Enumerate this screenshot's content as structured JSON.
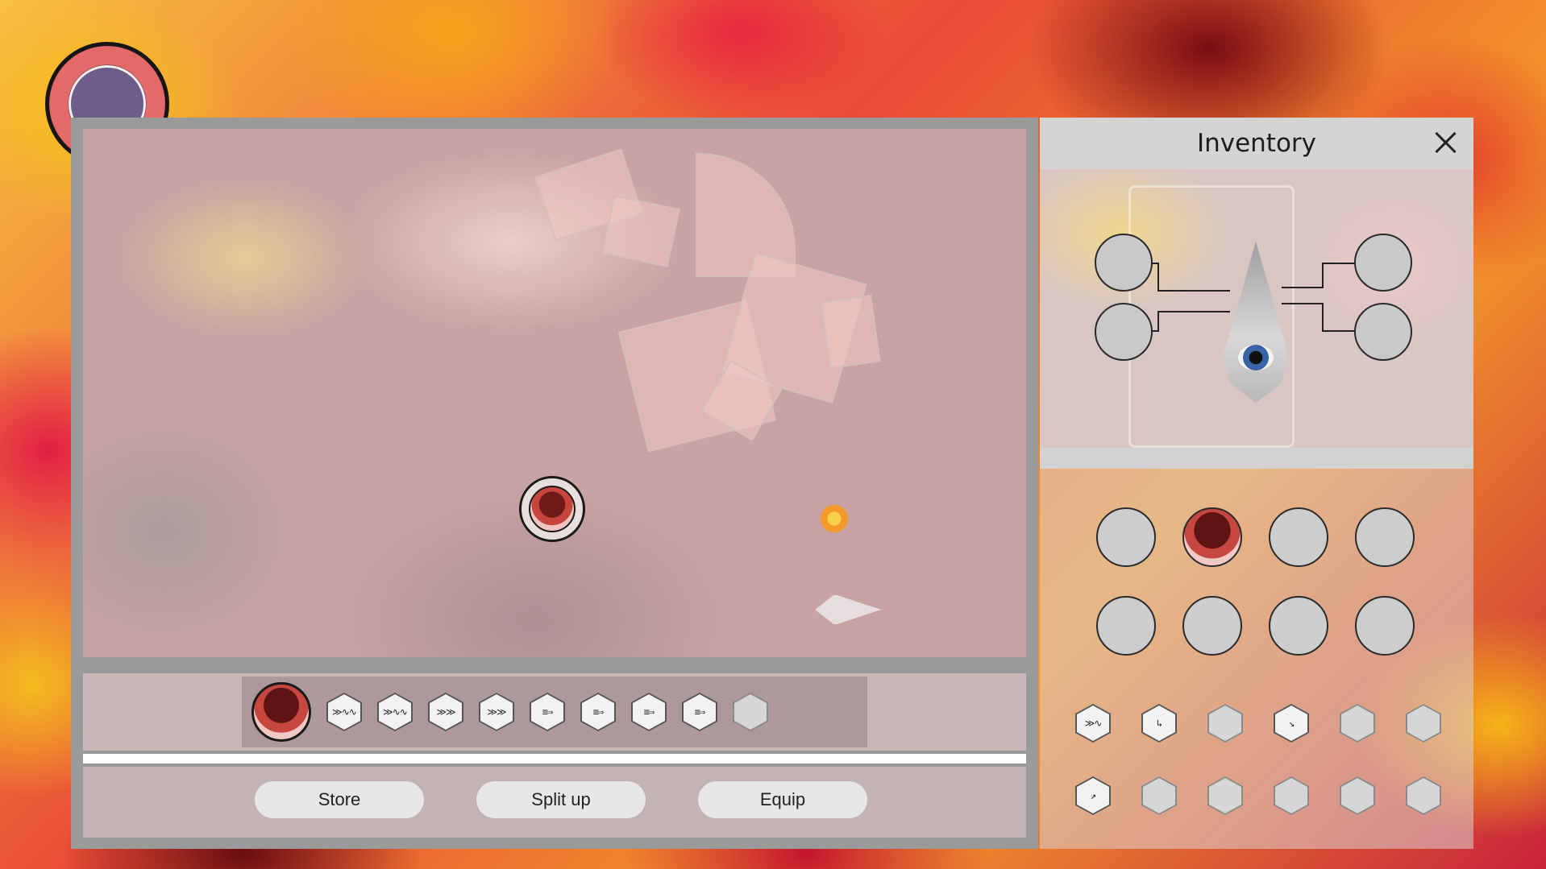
{
  "inventory": {
    "title": "Inventory",
    "close_icon": "close-icon"
  },
  "actions": {
    "store_label": "Store",
    "split_label": "Split up",
    "equip_label": "Equip"
  },
  "hotbar": {
    "slots": [
      {
        "kind": "orb",
        "icon": "core-orb-icon"
      },
      {
        "kind": "hex",
        "glyph": "≫∿∿"
      },
      {
        "kind": "hex",
        "glyph": "≫∿∿"
      },
      {
        "kind": "hex",
        "glyph": "≫≫"
      },
      {
        "kind": "hex",
        "glyph": "≫≫"
      },
      {
        "kind": "hex",
        "glyph": "≡⇒"
      },
      {
        "kind": "hex",
        "glyph": "≡⇒"
      },
      {
        "kind": "hex",
        "glyph": "≡⇒"
      },
      {
        "kind": "hex",
        "glyph": "≡⇒"
      },
      {
        "kind": "hex",
        "glyph": ""
      }
    ]
  },
  "inventory_grid": {
    "orb_slots": [
      false,
      true,
      false,
      false,
      false,
      false,
      false,
      false
    ],
    "hex_glyphs": [
      "≫∿",
      "↳",
      "",
      "↘",
      "",
      "",
      "↗",
      "",
      "",
      "",
      "",
      ""
    ]
  },
  "colors": {
    "accent_red": "#c64640",
    "panel_gray": "#9a9a9a",
    "slot_gray": "#cdcdcd"
  }
}
